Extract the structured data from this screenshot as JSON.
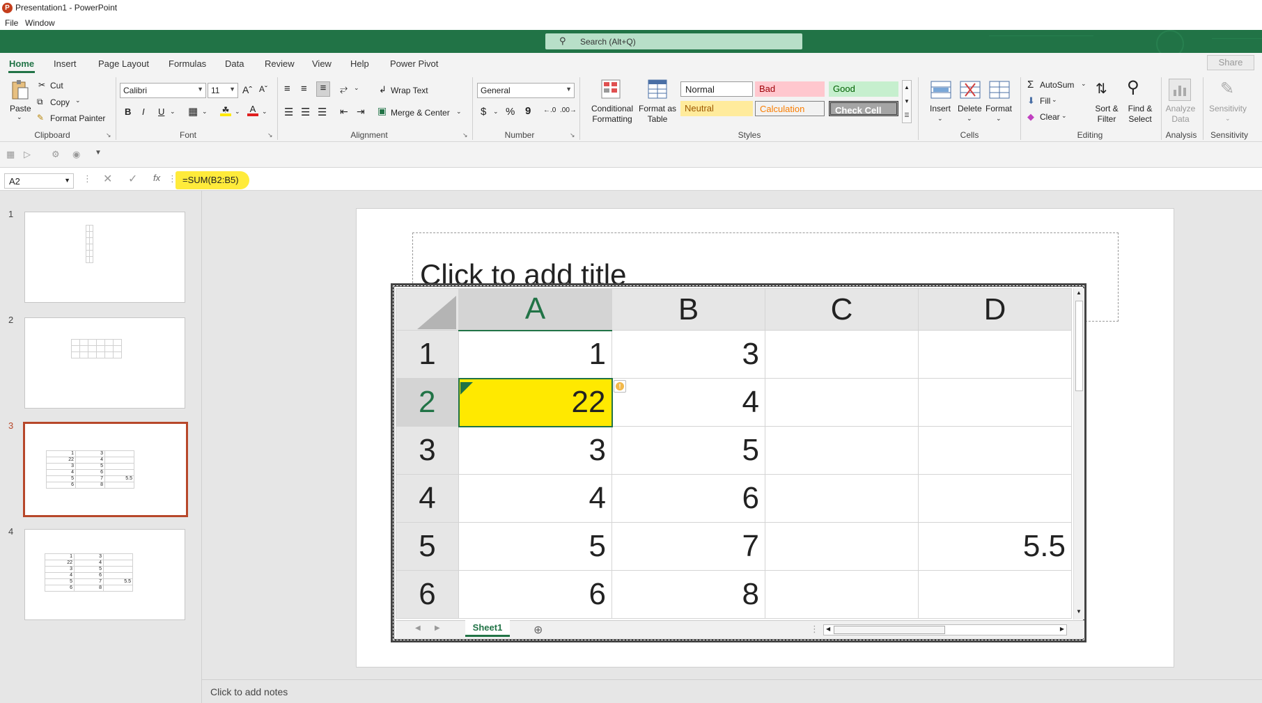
{
  "window": {
    "title": "Presentation1 - PowerPoint",
    "app_icon_letter": "P"
  },
  "menu": [
    "File",
    "Window"
  ],
  "search": {
    "placeholder": "Search (Alt+Q)"
  },
  "tabs": [
    "Home",
    "Insert",
    "Page Layout",
    "Formulas",
    "Data",
    "Review",
    "View",
    "Help",
    "Power Pivot"
  ],
  "share_label": "Share",
  "ribbon": {
    "clipboard": {
      "paste": "Paste",
      "cut": "Cut",
      "copy": "Copy",
      "format_painter": "Format Painter",
      "label": "Clipboard"
    },
    "font": {
      "name": "Calibri",
      "size": "11",
      "label": "Font",
      "bold": "B",
      "italic": "I",
      "underline": "U"
    },
    "alignment": {
      "wrap_text": "Wrap Text",
      "merge_center": "Merge & Center",
      "label": "Alignment"
    },
    "number": {
      "format": "General",
      "label": "Number",
      "currency": "$",
      "percent": "%",
      "comma": "9"
    },
    "styles": {
      "conditional_formatting": "Conditional Formatting",
      "format_as_table": "Format as Table",
      "normal": "Normal",
      "bad": "Bad",
      "good": "Good",
      "neutral": "Neutral",
      "calculation": "Calculation",
      "check_cell": "Check Cell",
      "label": "Styles"
    },
    "cells": {
      "insert": "Insert",
      "delete": "Delete",
      "format": "Format",
      "label": "Cells"
    },
    "editing": {
      "autosum": "AutoSum",
      "fill": "Fill",
      "clear": "Clear",
      "sort_filter": "Sort & Filter",
      "find_select": "Find & Select",
      "label": "Editing"
    },
    "analysis": {
      "analyze_data": "Analyze Data",
      "label": "Analysis"
    },
    "sensitivity": {
      "button": "Sensitivity",
      "label": "Sensitivity"
    }
  },
  "formula_bar": {
    "name_box": "A2",
    "formula": "=SUM(B2:B5)",
    "fx": "fx"
  },
  "thumbnails": [
    {
      "num": "1"
    },
    {
      "num": "2"
    },
    {
      "num": "3",
      "rows": [
        [
          "1",
          "3",
          ""
        ],
        [
          "22",
          "4",
          ""
        ],
        [
          "3",
          "5",
          ""
        ],
        [
          "4",
          "6",
          ""
        ],
        [
          "5",
          "7",
          "5.5"
        ],
        [
          "6",
          "8",
          ""
        ]
      ]
    },
    {
      "num": "4",
      "rows": [
        [
          "1",
          "3",
          ""
        ],
        [
          "22",
          "4",
          ""
        ],
        [
          "3",
          "5",
          ""
        ],
        [
          "4",
          "6",
          ""
        ],
        [
          "5",
          "7",
          "5.5"
        ],
        [
          "6",
          "8",
          ""
        ]
      ]
    }
  ],
  "slide": {
    "title_placeholder": "Click to add title"
  },
  "sheet": {
    "columns": [
      "A",
      "B",
      "C",
      "D"
    ],
    "rows": [
      {
        "header": "1",
        "cells": [
          "1",
          "3",
          "",
          ""
        ]
      },
      {
        "header": "2",
        "cells": [
          "22",
          "4",
          "",
          ""
        ]
      },
      {
        "header": "3",
        "cells": [
          "3",
          "5",
          "",
          ""
        ]
      },
      {
        "header": "4",
        "cells": [
          "4",
          "6",
          "",
          ""
        ]
      },
      {
        "header": "5",
        "cells": [
          "5",
          "7",
          "",
          "5.5"
        ]
      },
      {
        "header": "6",
        "cells": [
          "6",
          "8",
          "",
          ""
        ]
      }
    ],
    "tab": "Sheet1"
  },
  "notes_placeholder": "Click to add notes",
  "colors": {
    "excel_green": "#217346",
    "highlight": "#ffe900",
    "ppt_red": "#b7472a"
  }
}
